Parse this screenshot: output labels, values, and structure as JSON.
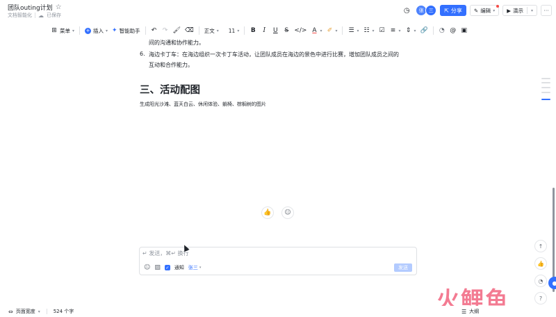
{
  "header": {
    "title": "团队outing计划",
    "subtitle_left": "文档智能化",
    "save_status": "已保存",
    "avatar_initial": "张",
    "avatar_second": "三",
    "share_label": "分享",
    "edit_label": "编辑",
    "present_label": "演示",
    "more_label": "···"
  },
  "toolbar": {
    "menu_label": "菜单",
    "insert_label": "插入",
    "ai_label": "智能助手",
    "font_label": "正文",
    "size_label": "11"
  },
  "content": {
    "prev_line": "间的沟通和协作能力。",
    "item6_num": "6.",
    "item6_line1": "海边卡丁车：在海边组织一次卡丁车活动，让团队成员在海边的景色中进行比赛，增加团队成员之间的",
    "item6_line2": "互动和合作能力。",
    "heading": "三、活动配图",
    "paragraph": "生成阳光沙滩、蓝天白云、休闲体验、躺椅、棕榈树的图片"
  },
  "comment": {
    "placeholder": "↵ 发送，⌘↵ 换行",
    "notify_label": "通知",
    "notify_user": "张三",
    "send_label": "发送"
  },
  "footer": {
    "page_width_label": "页面宽度",
    "word_count": "524 个字",
    "outline_label": "大纲"
  },
  "watermark": {
    "text": "火鲤鱼"
  },
  "colors": {
    "accent": "#3370ff",
    "send_disabled": "#b3cbff",
    "watermark": "#f0506e"
  }
}
